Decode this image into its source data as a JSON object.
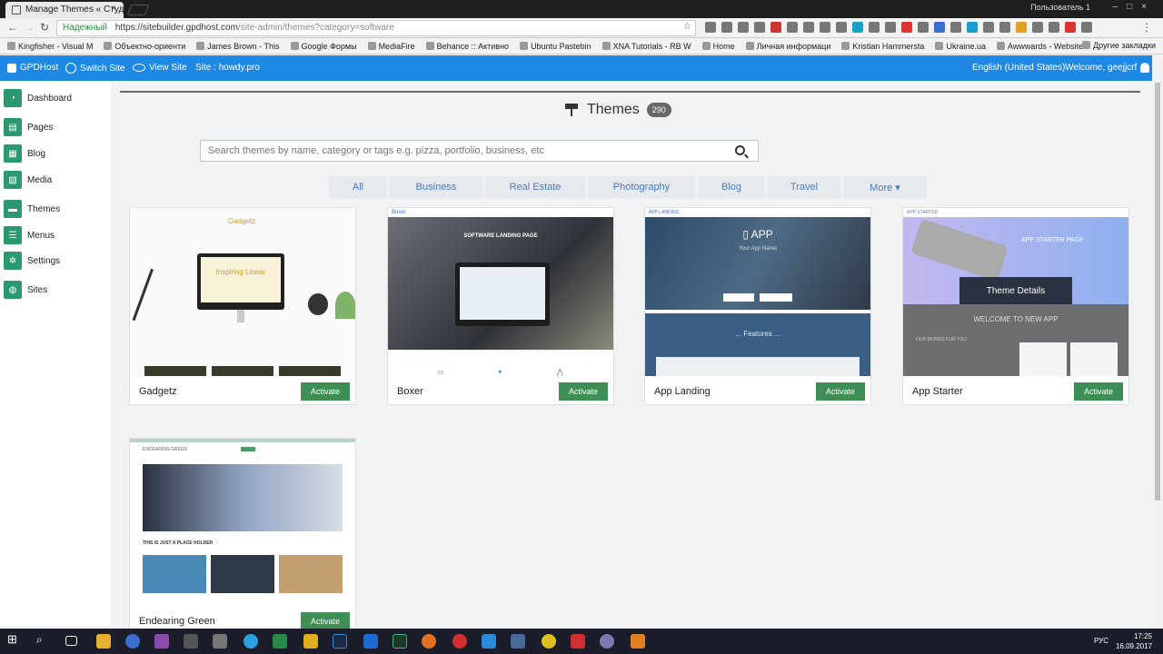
{
  "browser": {
    "tab_title": "Manage Themes « Студи",
    "tab_close": "×",
    "profile": "Пользователь 1",
    "secure_label": "Надежный",
    "url_host": "https://sitebuilder.gpdhost.com",
    "url_path": "/site-admin/themes?category=software",
    "bookmarks": [
      "Kingfisher - Visual M",
      "Объектно-ориенти",
      "James Brown - This",
      "Google Формы",
      "MediaFire",
      "Behance :: Активно",
      "Ubuntu Pastebin",
      "XNA Tutorials - RB W",
      "Home",
      "Личная информаци",
      "Kristian Hammersta",
      "Ukraine.ua",
      "Awwwards - Website"
    ],
    "bookmarks_more": "Другие закладки"
  },
  "appbar": {
    "brand": "GPDHost",
    "switch_site": "Switch Site",
    "view_site": "View Site",
    "site_label": "Site : howdy.pro",
    "language": "English (United States)",
    "welcome": "Welcome, geejjcrf"
  },
  "sidebar": {
    "items": [
      {
        "label": "Dashboard",
        "icon": "dashboard-icon"
      },
      {
        "label": "Pages",
        "icon": "pages-icon"
      },
      {
        "label": "Blog",
        "icon": "blog-icon"
      },
      {
        "label": "Media",
        "icon": "media-icon"
      },
      {
        "label": "Themes",
        "icon": "themes-icon"
      },
      {
        "label": "Menus",
        "icon": "menus-icon"
      },
      {
        "label": "Settings",
        "icon": "settings-icon"
      },
      {
        "label": "Sites",
        "icon": "sites-icon"
      }
    ]
  },
  "main": {
    "title": "Themes",
    "count": "290",
    "search_placeholder": "Search themes by name, category or tags e.g. pizza, portfolio, business, etc",
    "categories": [
      "All",
      "Business",
      "Real Estate",
      "Photography",
      "Blog",
      "Travel",
      "More ▾"
    ],
    "activate_label": "Activate",
    "tooltip": "Theme Details",
    "themes": [
      {
        "name": "Gadgetz"
      },
      {
        "name": "Boxer"
      },
      {
        "name": "App Landing"
      },
      {
        "name": "App Starter"
      },
      {
        "name": "Endearing Green"
      }
    ]
  },
  "previews": {
    "gadgetz_heading": "Gadgetz",
    "gadgetz_screen": "Inspiring Linear",
    "boxer_logo": "Boxer",
    "boxer_heading": "SOFTWARE LANDING PAGE",
    "applanding_logo": "APP LANDING",
    "applanding_heading": "▯ APP",
    "applanding_sub": "Your App Name",
    "applanding_features": "... Features ...",
    "appstarter_logo": "APP STARTER",
    "appstarter_heading": "APP STARTER PAGE",
    "appstarter_welcome": "WELCOME TO NEW APP",
    "appstarter_subtitle": "OUR WORDS FOR YOU",
    "endearing_logo": "ENDEARING GREEN",
    "endearing_placeholder": "THIS IS JUST A PLACE HOLDER"
  },
  "taskbar": {
    "lang": "РУС",
    "time": "17:25",
    "date": "16.09.2017"
  },
  "colors": {
    "appbar": "#1e88e5",
    "sidebar_icon": "#2a9a6e",
    "activate": "#3e8e56",
    "category_text": "#4a7ab8"
  }
}
